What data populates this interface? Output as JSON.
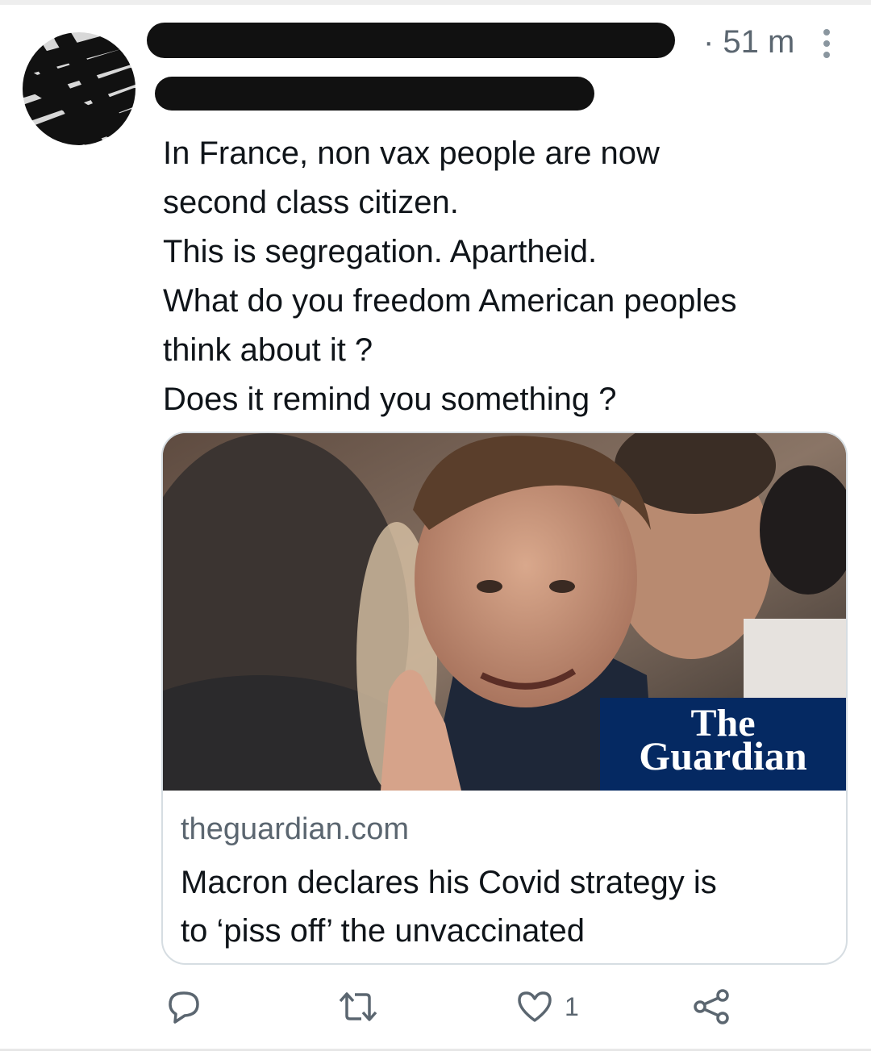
{
  "tweet": {
    "timestamp": "· 51 m",
    "text_lines": [
      "In France, non vax people are now",
      "second class citizen.",
      "This is segregation. Apartheid.",
      "What do you freedom American peoples",
      "think about it ?",
      "Does it remind you something ?"
    ]
  },
  "card": {
    "badge_line1": "The",
    "badge_line2": "Guardian",
    "domain": "theguardian.com",
    "title_line1": "Macron declares his Covid strategy is",
    "title_line2": "to ‘piss off’ the unvaccinated"
  },
  "actions": {
    "like_count": "1"
  },
  "colors": {
    "text": "#0f1419",
    "secondary": "#5b6670",
    "guardian_blue": "#052962",
    "border": "#d6dde2"
  },
  "icons": [
    "more-icon",
    "reply-icon",
    "retweet-icon",
    "like-icon",
    "share-icon"
  ]
}
